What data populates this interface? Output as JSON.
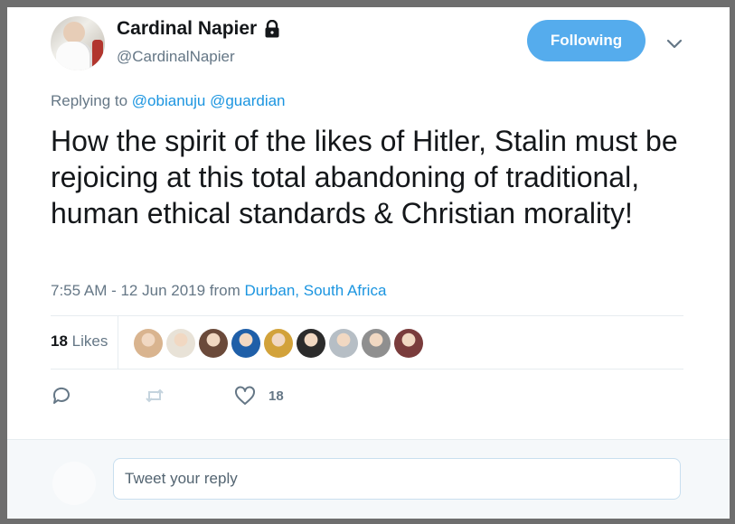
{
  "author": {
    "name": "Cardinal Napier",
    "handle": "@CardinalNapier",
    "protected_icon": "lock-icon"
  },
  "follow_button": {
    "label": "Following",
    "color": "#55aced"
  },
  "menu": {
    "icon": "chevron-down-icon"
  },
  "replying": {
    "prefix": "Replying to",
    "mentions": [
      "@obianuju",
      "@guardian"
    ]
  },
  "tweet": {
    "text": "How the spirit of the likes of Hitler, Stalin must be rejoicing at this total abandoning of traditional, human ethical standards & Christian morality!"
  },
  "meta": {
    "time": "7:55 AM - 12 Jun 2019 from",
    "location": "Durban, South Africa"
  },
  "likes": {
    "count": "18",
    "label": "Likes",
    "liker_colors": [
      "#d9b48f",
      "#e8e2d7",
      "#6b4a3a",
      "#1f5fa8",
      "#d2a23a",
      "#2b2b2b",
      "#b6bec5",
      "#8f8f8f",
      "#7a3c3c"
    ]
  },
  "actions": {
    "reply_icon": "reply-icon",
    "retweet_icon": "retweet-icon",
    "like_icon": "heart-icon",
    "like_count": "18"
  },
  "reply_box": {
    "placeholder": "Tweet your reply"
  },
  "colors": {
    "link": "#1b95e0",
    "muted": "#657786",
    "text": "#14171a"
  }
}
